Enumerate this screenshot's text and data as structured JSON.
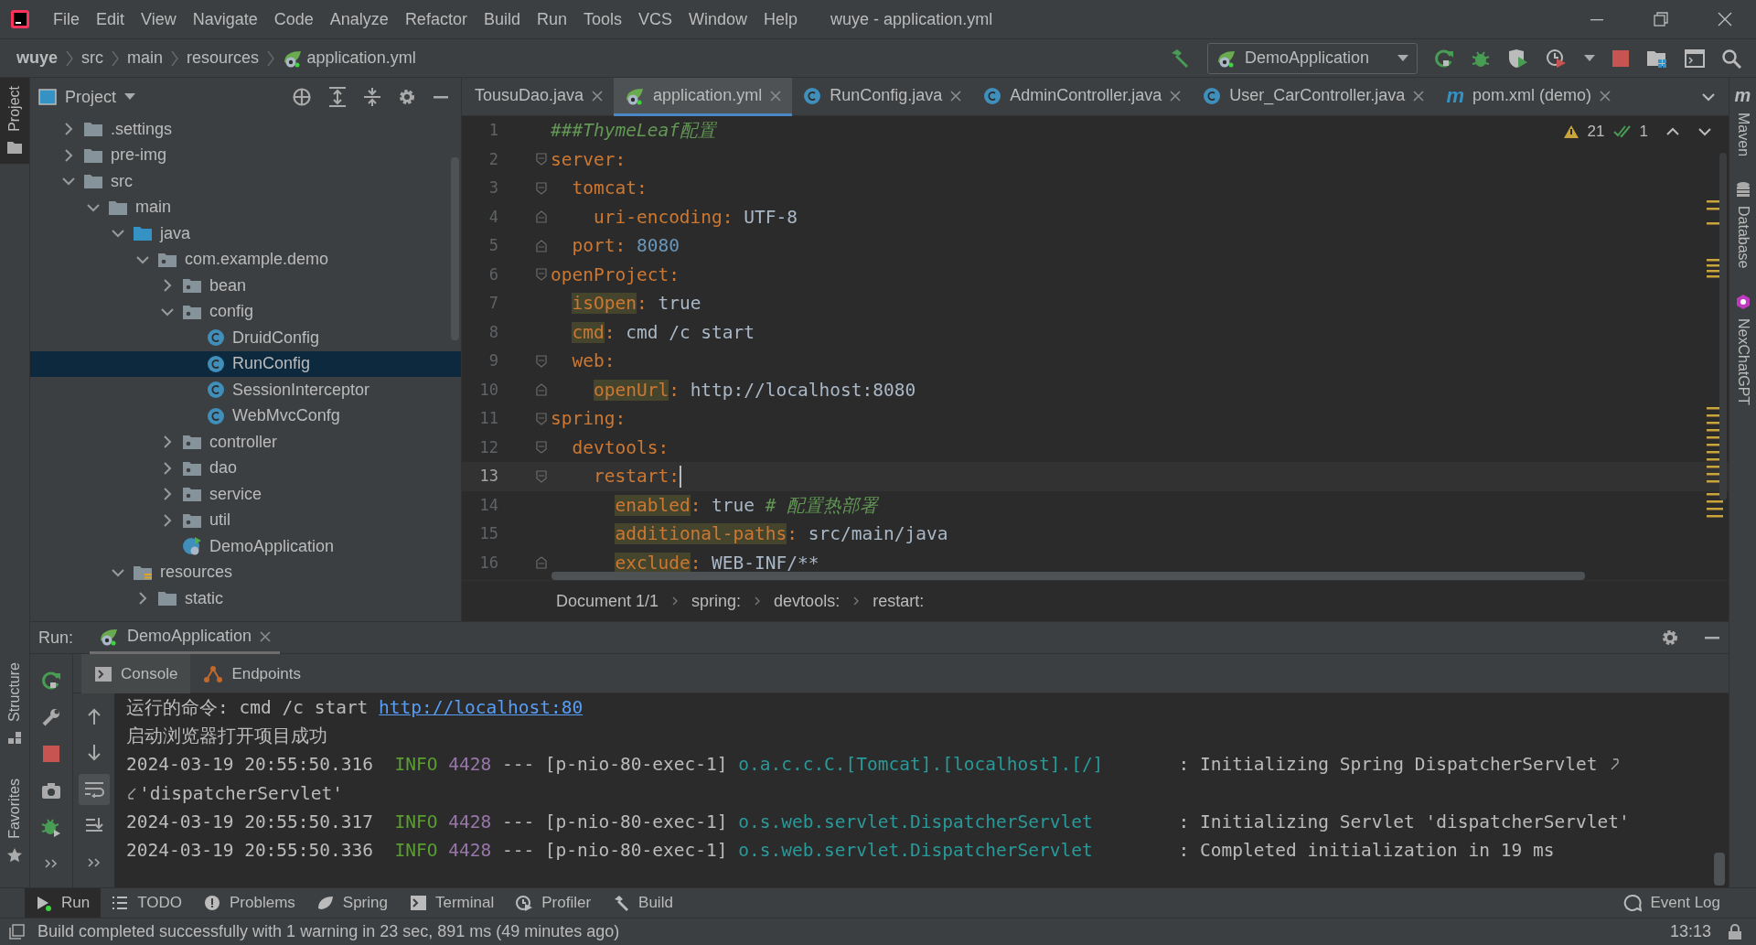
{
  "window": {
    "title": "wuye - application.yml"
  },
  "menu": [
    "File",
    "Edit",
    "View",
    "Navigate",
    "Code",
    "Analyze",
    "Refactor",
    "Build",
    "Run",
    "Tools",
    "VCS",
    "Window",
    "Help"
  ],
  "breadcrumb": [
    {
      "label": "wuye",
      "kind": "project"
    },
    {
      "label": "src",
      "kind": "dir"
    },
    {
      "label": "main",
      "kind": "dir"
    },
    {
      "label": "resources",
      "kind": "dir"
    },
    {
      "label": "application.yml",
      "kind": "yaml"
    }
  ],
  "run_config": {
    "label": "DemoApplication"
  },
  "left_stripe": {
    "top": [
      {
        "label": "Project",
        "kind": "folder",
        "selected": true
      }
    ],
    "bottom": [
      {
        "label": "Structure",
        "kind": "structure",
        "selected": false
      },
      {
        "label": "Favorites",
        "kind": "star",
        "selected": false
      }
    ]
  },
  "project_panel": {
    "title": "Project",
    "tree": [
      {
        "label": ".settings",
        "kind": "folder",
        "expanded": false,
        "selected": false
      },
      {
        "label": "pre-img",
        "kind": "folder",
        "expanded": false,
        "selected": false
      },
      {
        "label": "src",
        "kind": "folder",
        "expanded": true,
        "selected": false,
        "children": [
          {
            "label": "main",
            "kind": "folder",
            "expanded": true,
            "selected": false,
            "children": [
              {
                "label": "java",
                "kind": "source_folder",
                "expanded": true,
                "selected": false,
                "children": [
                  {
                    "label": "com.example.demo",
                    "kind": "package",
                    "expanded": true,
                    "selected": false,
                    "children": [
                      {
                        "label": "bean",
                        "kind": "package",
                        "expanded": false,
                        "selected": false
                      },
                      {
                        "label": "config",
                        "kind": "package",
                        "expanded": true,
                        "selected": false,
                        "children": [
                          {
                            "label": "DruidConfig",
                            "kind": "class",
                            "selected": false
                          },
                          {
                            "label": "RunConfig",
                            "kind": "class",
                            "selected": true
                          },
                          {
                            "label": "SessionInterceptor",
                            "kind": "class",
                            "selected": false
                          },
                          {
                            "label": "WebMvcConfg",
                            "kind": "class",
                            "selected": false
                          }
                        ]
                      },
                      {
                        "label": "controller",
                        "kind": "package",
                        "expanded": false,
                        "selected": false
                      },
                      {
                        "label": "dao",
                        "kind": "package",
                        "expanded": false,
                        "selected": false
                      },
                      {
                        "label": "service",
                        "kind": "package",
                        "expanded": false,
                        "selected": false
                      },
                      {
                        "label": "util",
                        "kind": "package",
                        "expanded": false,
                        "selected": false
                      },
                      {
                        "label": "DemoApplication",
                        "kind": "spring_class",
                        "selected": false
                      }
                    ]
                  }
                ]
              },
              {
                "label": "resources",
                "kind": "resource_folder",
                "expanded": true,
                "selected": false,
                "children": [
                  {
                    "label": "static",
                    "kind": "folder",
                    "expanded": false,
                    "selected": false
                  }
                ]
              }
            ]
          }
        ]
      }
    ]
  },
  "editor": {
    "tabs": [
      {
        "label": "TousuDao.java",
        "kind": "java",
        "selected": false
      },
      {
        "label": "application.yml",
        "kind": "yaml",
        "selected": true
      },
      {
        "label": "RunConfig.java",
        "kind": "java",
        "selected": false
      },
      {
        "label": "AdminController.java",
        "kind": "java",
        "selected": false
      },
      {
        "label": "User_CarController.java",
        "kind": "java",
        "selected": false
      },
      {
        "label": "pom.xml (demo)",
        "kind": "maven",
        "glyph": "m",
        "selected": false
      }
    ],
    "inspections": {
      "warnings": "21",
      "weak_warnings": "1"
    },
    "lines": [
      {
        "number": "1",
        "kind": "plain",
        "current": false,
        "segments": [
          {
            "kind": "comment",
            "text": "###ThymeLeaf配置"
          }
        ]
      },
      {
        "number": "2",
        "kind": "fold_start",
        "current": false,
        "segments": [
          {
            "kind": "key",
            "text": "server"
          },
          {
            "kind": "punct",
            "text": ":"
          }
        ],
        "children": [
          {
            "number": "3",
            "kind": "fold_start",
            "current": false,
            "segments": [
              {
                "kind": "key",
                "text": "tomcat"
              },
              {
                "kind": "punct",
                "text": ":"
              }
            ],
            "children": [
              {
                "number": "4",
                "kind": "fold_end",
                "current": false,
                "segments": [
                  {
                    "kind": "key",
                    "text": "uri-encoding"
                  },
                  {
                    "kind": "punct",
                    "text": ":"
                  },
                  {
                    "kind": "value",
                    "text": " UTF-8"
                  }
                ]
              }
            ]
          },
          {
            "number": "5",
            "kind": "fold_end",
            "current": false,
            "segments": [
              {
                "kind": "key",
                "text": "port"
              },
              {
                "kind": "punct",
                "text": ":"
              },
              {
                "kind": "number",
                "text": " 8080"
              }
            ]
          }
        ]
      },
      {
        "number": "6",
        "kind": "fold_start",
        "current": false,
        "segments": [
          {
            "kind": "key",
            "text": "openProject"
          },
          {
            "kind": "punct",
            "text": ":"
          }
        ],
        "children": [
          {
            "number": "7",
            "kind": "plain",
            "current": false,
            "segments": [
              {
                "kind": "marked_key",
                "text": "isOpen"
              },
              {
                "kind": "punct",
                "text": ":"
              },
              {
                "kind": "value",
                "text": " true"
              }
            ]
          },
          {
            "number": "8",
            "kind": "plain",
            "current": false,
            "segments": [
              {
                "kind": "marked_key",
                "text": "cmd"
              },
              {
                "kind": "punct",
                "text": ":"
              },
              {
                "kind": "value",
                "text": " cmd /c start"
              }
            ]
          },
          {
            "number": "9",
            "kind": "fold_start",
            "current": false,
            "segments": [
              {
                "kind": "key",
                "text": "web"
              },
              {
                "kind": "punct",
                "text": ":"
              }
            ],
            "children": [
              {
                "number": "10",
                "kind": "fold_end",
                "current": false,
                "segments": [
                  {
                    "kind": "marked_key",
                    "text": "openUrl"
                  },
                  {
                    "kind": "punct",
                    "text": ":"
                  },
                  {
                    "kind": "value",
                    "text": " http://localhost:8080"
                  }
                ]
              }
            ]
          }
        ]
      },
      {
        "number": "11",
        "kind": "fold_start",
        "current": false,
        "segments": [
          {
            "kind": "key",
            "text": "spring"
          },
          {
            "kind": "punct",
            "text": ":"
          }
        ],
        "children": [
          {
            "number": "12",
            "kind": "fold_start",
            "current": false,
            "segments": [
              {
                "kind": "key",
                "text": "devtools"
              },
              {
                "kind": "punct",
                "text": ":"
              }
            ],
            "children": [
              {
                "number": "13",
                "kind": "fold_start",
                "current": true,
                "segments": [
                  {
                    "kind": "key",
                    "text": "restart"
                  },
                  {
                    "kind": "punct",
                    "text": ":"
                  }
                ],
                "children": [
                  {
                    "number": "14",
                    "kind": "plain",
                    "current": false,
                    "segments": [
                      {
                        "kind": "marked_key",
                        "text": "enabled"
                      },
                      {
                        "kind": "punct",
                        "text": ":"
                      },
                      {
                        "kind": "value",
                        "text": " true "
                      },
                      {
                        "kind": "comment",
                        "text": "# 配置热部署"
                      }
                    ]
                  },
                  {
                    "number": "15",
                    "kind": "plain",
                    "current": false,
                    "segments": [
                      {
                        "kind": "marked_key",
                        "text": "additional-paths"
                      },
                      {
                        "kind": "punct",
                        "text": ":"
                      },
                      {
                        "kind": "value",
                        "text": " src/main/java"
                      }
                    ]
                  },
                  {
                    "number": "16",
                    "kind": "fold_end",
                    "current": false,
                    "segments": [
                      {
                        "kind": "marked_key",
                        "text": "exclude"
                      },
                      {
                        "kind": "punct",
                        "text": ":"
                      },
                      {
                        "kind": "value",
                        "text": " WEB-INF/**"
                      }
                    ]
                  }
                ]
              }
            ]
          }
        ]
      }
    ],
    "path": [
      "Document 1/1",
      "spring:",
      "devtools:",
      "restart:"
    ]
  },
  "right_stripe": [
    {
      "label": "Maven",
      "kind": "maven",
      "glyph": "m"
    },
    {
      "label": "Database",
      "kind": "database"
    },
    {
      "label": "NexChatGPT",
      "kind": "chatgpt"
    }
  ],
  "run_panel": {
    "label": "Run:",
    "tab": "DemoApplication",
    "soft_wrap_selected": true,
    "subtabs": [
      {
        "label": "Console",
        "kind": "console",
        "selected": true
      },
      {
        "label": "Endpoints",
        "kind": "endpoints",
        "selected": false
      }
    ],
    "console": [
      {
        "kind": "plain",
        "segments": [
          {
            "kind": "text",
            "text": "运行的命令: cmd /c start "
          },
          {
            "kind": "link",
            "text": "http://localhost:80"
          }
        ]
      },
      {
        "kind": "plain",
        "segments": [
          {
            "kind": "text",
            "text": "启动浏览器打开项目成功"
          }
        ]
      },
      {
        "kind": "wrapped",
        "segments": [
          {
            "kind": "text",
            "text": "2024-03-19 20:55:50.316  "
          },
          {
            "kind": "info",
            "text": "INFO"
          },
          {
            "kind": "pid",
            "text": " 4428"
          },
          {
            "kind": "text",
            "text": " --- [p-nio-80-exec-1] "
          },
          {
            "kind": "logger",
            "text": "o.a.c.c.C.[Tomcat].[localhost].[/]"
          },
          {
            "kind": "text",
            "text": "       : Initializing Spring DispatcherServlet"
          }
        ]
      },
      {
        "kind": "continuation",
        "segments": [
          {
            "kind": "text",
            "text": "'dispatcherServlet'"
          }
        ]
      },
      {
        "kind": "plain",
        "segments": [
          {
            "kind": "text",
            "text": "2024-03-19 20:55:50.317  "
          },
          {
            "kind": "info",
            "text": "INFO"
          },
          {
            "kind": "pid",
            "text": " 4428"
          },
          {
            "kind": "text",
            "text": " --- [p-nio-80-exec-1] "
          },
          {
            "kind": "logger",
            "text": "o.s.web.servlet.DispatcherServlet"
          },
          {
            "kind": "text",
            "text": "        : Initializing Servlet 'dispatcherServlet'"
          }
        ]
      },
      {
        "kind": "plain",
        "segments": [
          {
            "kind": "text",
            "text": "2024-03-19 20:55:50.336  "
          },
          {
            "kind": "info",
            "text": "INFO"
          },
          {
            "kind": "pid",
            "text": " 4428"
          },
          {
            "kind": "text",
            "text": " --- [p-nio-80-exec-1] "
          },
          {
            "kind": "logger",
            "text": "o.s.web.servlet.DispatcherServlet"
          },
          {
            "kind": "text",
            "text": "        : Completed initialization in 19 ms"
          }
        ]
      }
    ]
  },
  "tool_windows": [
    {
      "label": "Run",
      "kind": "run",
      "selected": true
    },
    {
      "label": "TODO",
      "kind": "todo",
      "selected": false
    },
    {
      "label": "Problems",
      "kind": "problems",
      "selected": false
    },
    {
      "label": "Spring",
      "kind": "spring",
      "selected": false
    },
    {
      "label": "Terminal",
      "kind": "terminal",
      "selected": false
    },
    {
      "label": "Profiler",
      "kind": "profiler",
      "selected": false
    },
    {
      "label": "Build",
      "kind": "build",
      "selected": false
    }
  ],
  "event_log": "Event Log",
  "status_bar": {
    "message": "Build completed successfully with 1 warning in 23 sec, 891 ms (49 minutes ago)",
    "position": "13:13"
  }
}
